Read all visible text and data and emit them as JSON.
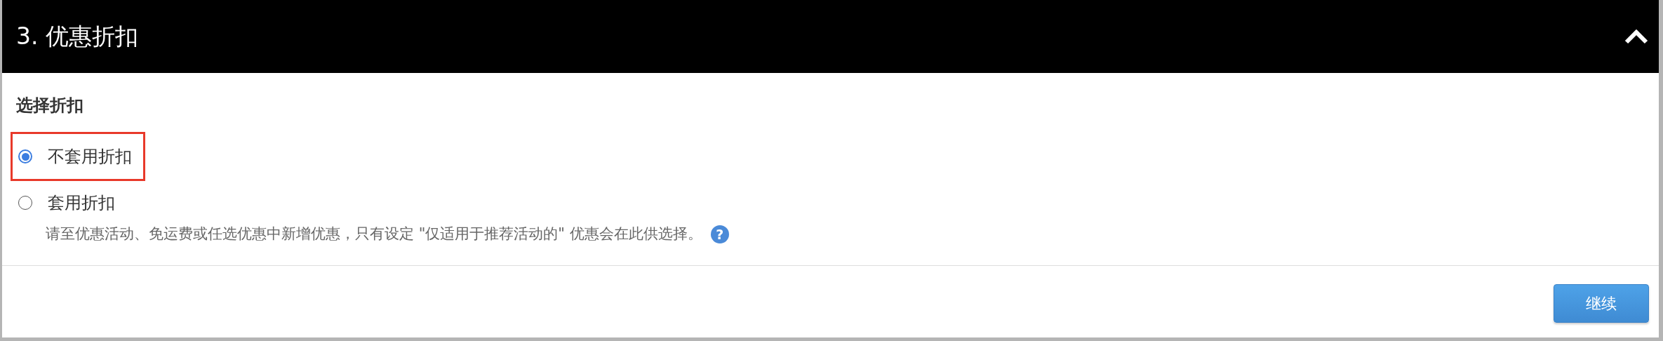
{
  "panel": {
    "title": "3. 优惠折扣",
    "expanded": true
  },
  "section": {
    "heading": "选择折扣",
    "options": [
      {
        "label": "不套用折扣",
        "selected": true,
        "highlighted": true
      },
      {
        "label": "套用折扣",
        "selected": false,
        "highlighted": false,
        "description": "请至优惠活动、免运费或任选优惠中新增优惠，只有设定 \"仅适用于推荐活动的\" 优惠会在此供选择。",
        "help": "?"
      }
    ]
  },
  "buttons": [
    {
      "label": "继续"
    }
  ]
}
